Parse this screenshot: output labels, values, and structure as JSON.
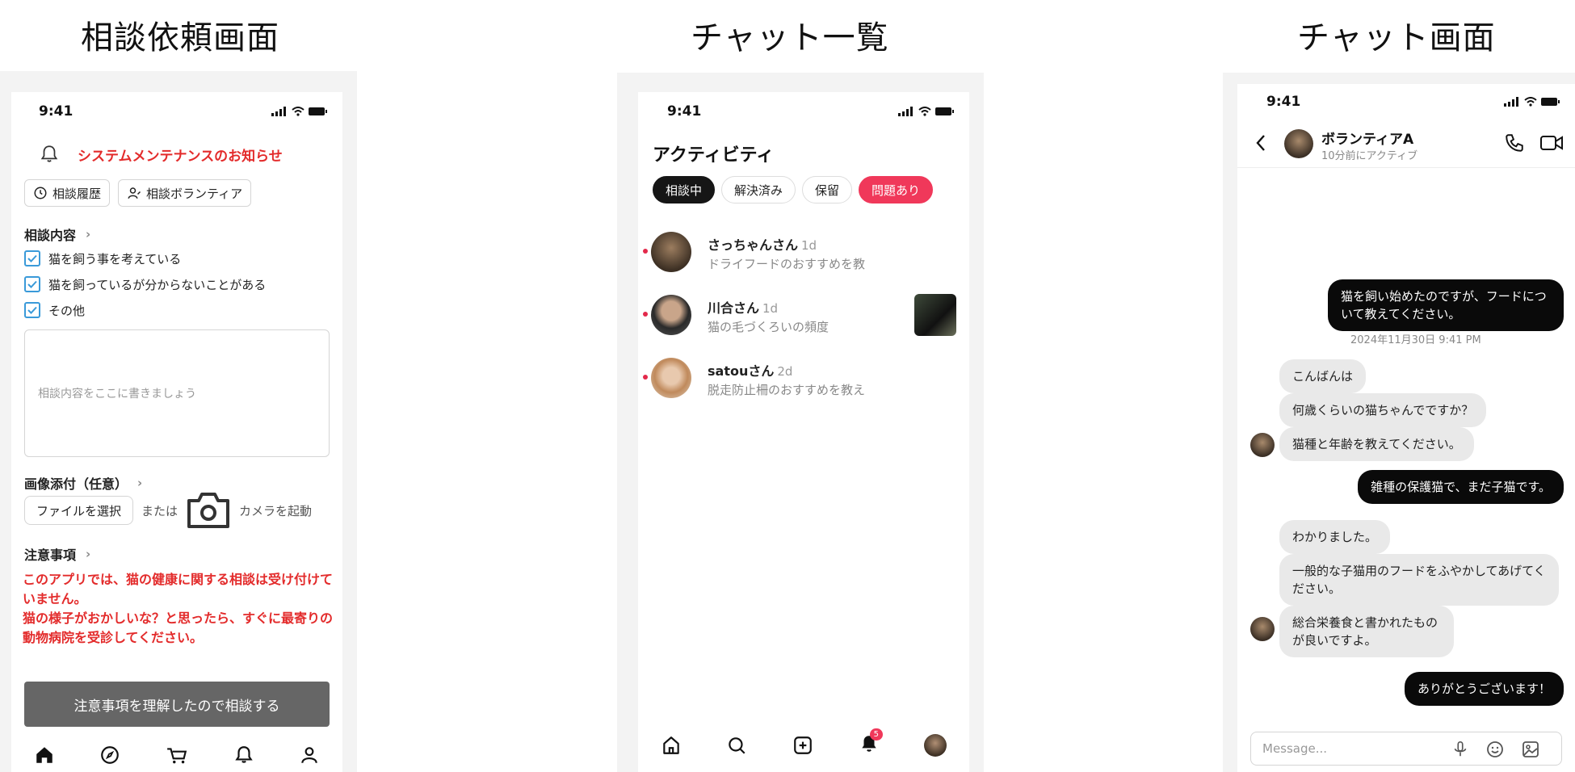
{
  "titles": {
    "consult": "相談依頼画面",
    "list": "チャット一覧",
    "chat": "チャット画面"
  },
  "status": {
    "time": "9:41"
  },
  "consult": {
    "notice": "システムメンテナンスのお知らせ",
    "history_btn": "相談履歴",
    "volunteer_btn": "相談ボランティア",
    "content_label": "相談内容",
    "checks": [
      {
        "label": "猫を飼う事を考えている",
        "checked": true
      },
      {
        "label": "猫を飼っているが分からないことがある",
        "checked": true
      },
      {
        "label": "その他",
        "checked": true
      }
    ],
    "textarea_placeholder": "相談内容をここに書きましょう",
    "image_label": "画像添付（任意）",
    "file_btn": "ファイルを選択",
    "or_text": "または",
    "camera_text": "カメラを起動",
    "caution_label": "注意事項",
    "warning_1": "このアプリでは、猫の健康に関する相談は受け付けていません。",
    "warning_2": "猫の様子がおかしいな？と思ったら、すぐに最寄りの動物病院を受診してください。",
    "submit": "注意事項を理解したので相談する",
    "tabbar": [
      "home-icon",
      "compass-icon",
      "cart-icon",
      "bell-icon",
      "profile-icon"
    ]
  },
  "list": {
    "header": "アクティビティ",
    "filters": [
      {
        "label": "相談中",
        "state": "active"
      },
      {
        "label": "解決済み",
        "state": "default"
      },
      {
        "label": "保留",
        "state": "default"
      },
      {
        "label": "問題あり",
        "state": "alert"
      }
    ],
    "chats": [
      {
        "name": "さっちゃんさん",
        "time": "1d",
        "message": "ドライフードのおすすめを教",
        "avatar_color": "#5a4a3c",
        "thumb": false
      },
      {
        "name": "川合さん",
        "time": "1d",
        "message": "猫の毛づくろいの頻度",
        "avatar_color": "#3a3a3a",
        "thumb": true
      },
      {
        "name": "satouさん",
        "time": "2d",
        "message": "脱走防止柵のおすすめを教え",
        "avatar_color": "#c79a6e",
        "thumb": false
      }
    ],
    "badge_count": "5",
    "tabbar": [
      "home-icon",
      "search-icon",
      "plus-square-icon",
      "bell-icon",
      "avatar"
    ]
  },
  "chat": {
    "name": "ボランティアA",
    "subtitle": "10分前にアクティブ",
    "messages": [
      {
        "side": "out",
        "text": "猫を飼い始めたのですが、フードについて教えてください。"
      },
      {
        "side": "ts",
        "text": "2024年11月30日 9:41 PM"
      },
      {
        "side": "in",
        "text": "こんばんは"
      },
      {
        "side": "in",
        "text": "何歳くらいの猫ちゃんでですか？"
      },
      {
        "side": "in",
        "text": "猫種と年齢を教えてください。"
      },
      {
        "side": "out",
        "text": "雑種の保護猫で、まだ子猫です。"
      },
      {
        "side": "in",
        "text": "わかりました。"
      },
      {
        "side": "in",
        "text": "一般的な子猫用のフードをふやかしてあげてください。"
      },
      {
        "side": "in",
        "text": "総合栄養食と書かれたものが良いですよ。"
      },
      {
        "side": "out",
        "text": "ありがとうございます！"
      }
    ],
    "input_placeholder": "Message..."
  },
  "colors": {
    "alert_red": "#e32b2b",
    "chip_red": "#f0385a",
    "check_blue": "#3a9ad9",
    "bubble_dark": "#0a0a0a",
    "bubble_light": "#e9e9e9"
  }
}
